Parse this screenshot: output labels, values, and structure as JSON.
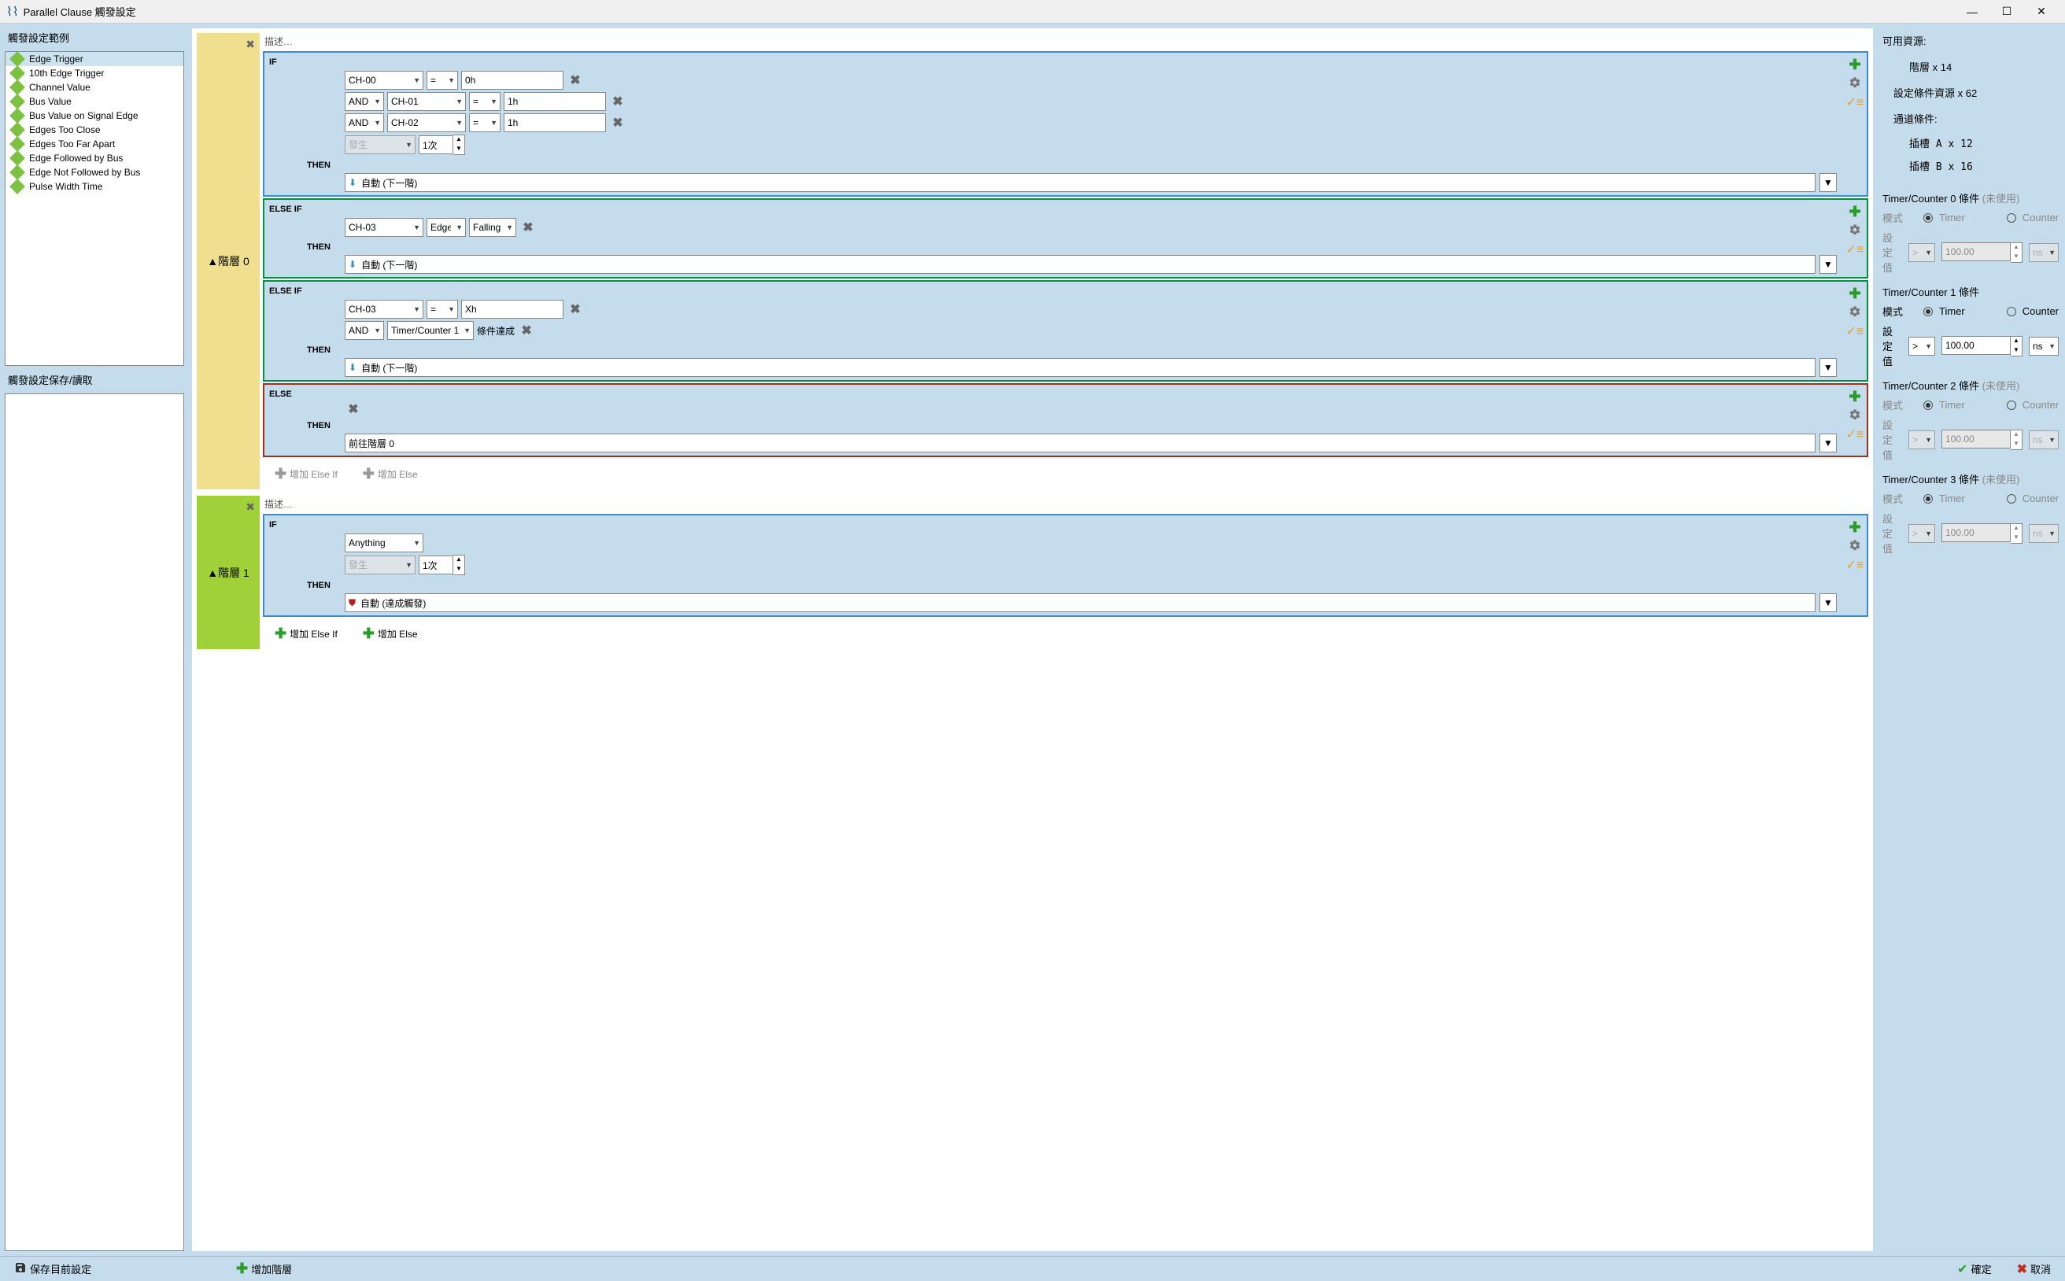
{
  "window": {
    "title": "Parallel Clause 觸發設定"
  },
  "left": {
    "examples_label": "觸發設定範例",
    "saveload_label": "觸發設定保存/讀取",
    "examples": [
      "Edge Trigger",
      "10th Edge Trigger",
      "Channel Value",
      "Bus Value",
      "Bus Value on Signal Edge",
      "Edges Too Close",
      "Edges Too Far Apart",
      "Edge Followed by Bus",
      "Edge Not Followed by Bus",
      "Pulse Width Time"
    ],
    "selected_index": 0
  },
  "levels": [
    {
      "name": "階層 0",
      "color": "yellow",
      "desc": "描述…",
      "clauses": [
        {
          "type": "IF",
          "conds": [
            {
              "pre": null,
              "ch": "CH-00",
              "op": "=",
              "val": "0h"
            },
            {
              "pre": "AND",
              "ch": "CH-01",
              "op": "=",
              "val": "1h"
            },
            {
              "pre": "AND",
              "ch": "CH-02",
              "op": "=",
              "val": "1h"
            }
          ],
          "occur": {
            "label": "發生",
            "count": "1次"
          },
          "then": "THEN",
          "action": {
            "icon": "arrow",
            "text": "自動 (下一階)"
          }
        },
        {
          "type": "ELSE IF",
          "border": "green",
          "conds": [
            {
              "pre": null,
              "ch": "CH-03",
              "mode": "Edge",
              "edge": "Falling"
            }
          ],
          "then": "THEN",
          "action": {
            "icon": "arrow",
            "text": "自動 (下一階)"
          }
        },
        {
          "type": "ELSE IF",
          "border": "green",
          "conds": [
            {
              "pre": null,
              "ch": "CH-03",
              "op": "=",
              "val": "Xh"
            },
            {
              "pre": "AND",
              "tc": "Timer/Counter 1",
              "tctext": "條件達成"
            }
          ],
          "then": "THEN",
          "action": {
            "icon": "arrow",
            "text": "自動 (下一階)"
          }
        },
        {
          "type": "ELSE",
          "border": "red",
          "then": "THEN",
          "action": {
            "icon": "none",
            "text": "前往階層 0"
          }
        }
      ],
      "add_elseif": "增加 Else If",
      "add_else": "增加 Else",
      "add_disabled": true
    },
    {
      "name": "階層 1",
      "color": "green",
      "desc": "描述…",
      "clauses": [
        {
          "type": "IF",
          "conds": [
            {
              "pre": null,
              "any": "Anything"
            }
          ],
          "occur": {
            "label": "發生",
            "count": "1次"
          },
          "then": "THEN",
          "action": {
            "icon": "shield",
            "text": "自動 (達成觸發)"
          }
        }
      ],
      "add_elseif": "增加 Else If",
      "add_else": "增加 Else",
      "add_disabled": false
    }
  ],
  "right": {
    "avail_label": "可用資源:",
    "level_line": "階層 x 14",
    "cond_res_line": "設定條件資源 x 62",
    "channel_cond_label": "通道條件:",
    "slot_a": "插槽 A x 12",
    "slot_b": "插槽 B x 16",
    "tcs": [
      {
        "title": "Timer/Counter 0 條件",
        "unused": "(未使用)",
        "disabled": true,
        "mode": "Timer",
        "mode2": "Counter",
        "mode_label": "模式",
        "val_label": "設定值",
        "op": ">",
        "val": "100.00",
        "unit": "ns"
      },
      {
        "title": "Timer/Counter 1 條件",
        "unused": "",
        "disabled": false,
        "mode": "Timer",
        "mode2": "Counter",
        "mode_label": "模式",
        "val_label": "設定值",
        "op": ">",
        "val": "100.00",
        "unit": "ns"
      },
      {
        "title": "Timer/Counter 2 條件",
        "unused": "(未使用)",
        "disabled": true,
        "mode": "Timer",
        "mode2": "Counter",
        "mode_label": "模式",
        "val_label": "設定值",
        "op": ">",
        "val": "100.00",
        "unit": "ns"
      },
      {
        "title": "Timer/Counter 3 條件",
        "unused": "(未使用)",
        "disabled": true,
        "mode": "Timer",
        "mode2": "Counter",
        "mode_label": "模式",
        "val_label": "設定值",
        "op": ">",
        "val": "100.00",
        "unit": "ns"
      }
    ]
  },
  "footer": {
    "save": "保存目前設定",
    "add_level": "增加階層",
    "ok": "確定",
    "cancel": "取消"
  }
}
